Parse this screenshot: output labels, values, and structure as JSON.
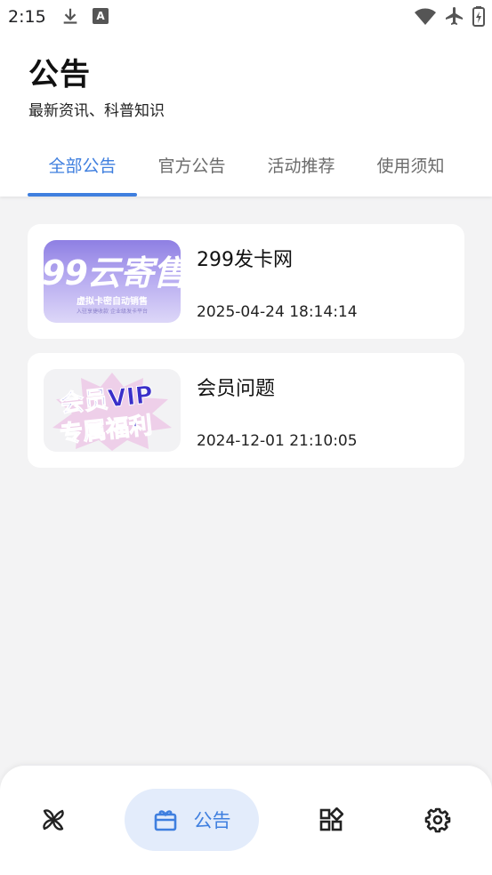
{
  "status": {
    "time": "2:15",
    "status_icon_letter": "A"
  },
  "header": {
    "title": "公告",
    "subtitle": "最新资讯、科普知识"
  },
  "tabs": [
    {
      "label": "全部公告",
      "active": true
    },
    {
      "label": "官方公告",
      "active": false
    },
    {
      "label": "活动推荐",
      "active": false
    },
    {
      "label": "使用须知",
      "active": false
    }
  ],
  "notices": [
    {
      "title": "299发卡网",
      "time": "2025-04-24 18:14:14",
      "thumb_text": "99云寄售",
      "thumb_line1": "虚拟卡密自动销售",
      "thumb_line2": "入驻享捷收款 企业级发卡平台"
    },
    {
      "title": "会员问题",
      "time": "2024-12-01 21:10:05",
      "thumb_line1": "会员VIP",
      "thumb_line2": "专属福利"
    }
  ],
  "bottom_nav": {
    "items": [
      {
        "name": "pinwheel-icon",
        "label": "",
        "active": false
      },
      {
        "name": "gift-icon",
        "label": "公告",
        "active": true
      },
      {
        "name": "apps-icon",
        "label": "",
        "active": false
      },
      {
        "name": "settings-icon",
        "label": "",
        "active": false
      }
    ]
  },
  "colors": {
    "accent": "#3f7fdf",
    "active_pill": "#e3ecfb",
    "background": "#f3f3f4"
  }
}
